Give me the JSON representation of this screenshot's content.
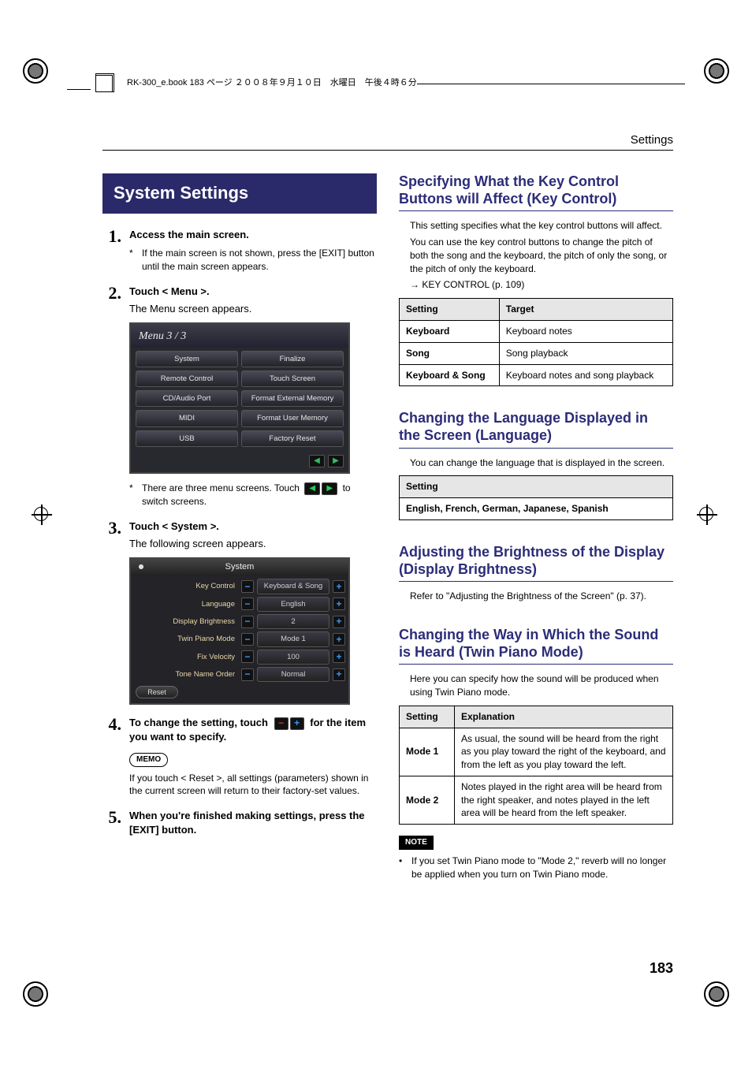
{
  "header": {
    "running_title": "Settings",
    "book_header_text": "RK-300_e.book 183 ページ ２００８年９月１０日　水曜日　午後４時６分"
  },
  "left": {
    "title": "System Settings",
    "steps": [
      {
        "num": "1.",
        "head": "Access the main screen.",
        "sub": "",
        "star": "If the main screen is not shown, press the [EXIT] button until the main screen appears."
      },
      {
        "num": "2.",
        "head": "Touch < Menu >.",
        "sub": "The Menu screen appears.",
        "star": ""
      },
      {
        "num": "3.",
        "head": "Touch < System >.",
        "sub": "The following screen appears.",
        "star": ""
      },
      {
        "num": "4.",
        "head_pre": "To change the setting, touch",
        "head_post": "for the item you want to specify.",
        "sub": "",
        "star": ""
      },
      {
        "num": "5.",
        "head": "When you're finished making settings, press the [EXIT] button.",
        "sub": "",
        "star": ""
      }
    ],
    "menu_screen": {
      "title": "Menu 3 / 3",
      "items": [
        "System",
        "Finalize",
        "Remote Control",
        "Touch Screen",
        "CD/Audio Port",
        "Format External Memory",
        "MIDI",
        "Format User Memory",
        "USB",
        "Factory Reset"
      ]
    },
    "menu_note_pre": "There are three menu screens. Touch",
    "menu_note_post": "to switch screens.",
    "system_screen": {
      "title": "System",
      "rows": [
        {
          "label": "Key Control",
          "value": "Keyboard & Song"
        },
        {
          "label": "Language",
          "value": "English"
        },
        {
          "label": "Display Brightness",
          "value": "2"
        },
        {
          "label": "Twin Piano Mode",
          "value": "Mode 1"
        },
        {
          "label": "Fix Velocity",
          "value": "100"
        },
        {
          "label": "Tone Name Order",
          "value": "Normal"
        }
      ],
      "reset": "Reset"
    },
    "memo_label": "MEMO",
    "memo_text": "If you touch < Reset >, all settings (parameters) shown in the current screen will return to their factory-set values."
  },
  "right": {
    "sec1": {
      "heading": "Specifying What the Key Control Buttons will Affect (Key Control)",
      "p1": "This setting specifies what the key control buttons will affect.",
      "p2": "You can use the key control buttons to change the pitch of both the song and the keyboard, the pitch of only the song, or the pitch of only the keyboard.",
      "ref": "→ KEY CONTROL (p. 109)",
      "table": {
        "head": [
          "Setting",
          "Target"
        ],
        "rows": [
          [
            "Keyboard",
            "Keyboard notes"
          ],
          [
            "Song",
            "Song playback"
          ],
          [
            "Keyboard & Song",
            "Keyboard notes and song playback"
          ]
        ]
      }
    },
    "sec2": {
      "heading": "Changing the Language Displayed in the Screen (Language)",
      "p1": "You can change the language that is displayed in the screen.",
      "table": {
        "head": "Setting",
        "value": "English, French, German, Japanese, Spanish"
      }
    },
    "sec3": {
      "heading": "Adjusting the Brightness of the Display (Display Brightness)",
      "p1": "Refer to \"Adjusting the Brightness of the Screen\" (p. 37)."
    },
    "sec4": {
      "heading": "Changing the Way in Which the Sound is Heard (Twin Piano Mode)",
      "p1": "Here you can specify how the sound will be produced when using Twin Piano mode.",
      "table": {
        "head": [
          "Setting",
          "Explanation"
        ],
        "rows": [
          [
            "Mode 1",
            "As usual, the sound will be heard from the right as you play toward the right of the keyboard, and from the left as you play toward the left."
          ],
          [
            "Mode 2",
            "Notes played in the right area will be heard from the right speaker, and notes played in the left area will be heard from the left speaker."
          ]
        ]
      },
      "note_label": "NOTE",
      "note_text": "If you set Twin Piano mode to \"Mode 2,\" reverb will no longer be applied when you turn on Twin Piano mode."
    }
  },
  "page_number": "183"
}
